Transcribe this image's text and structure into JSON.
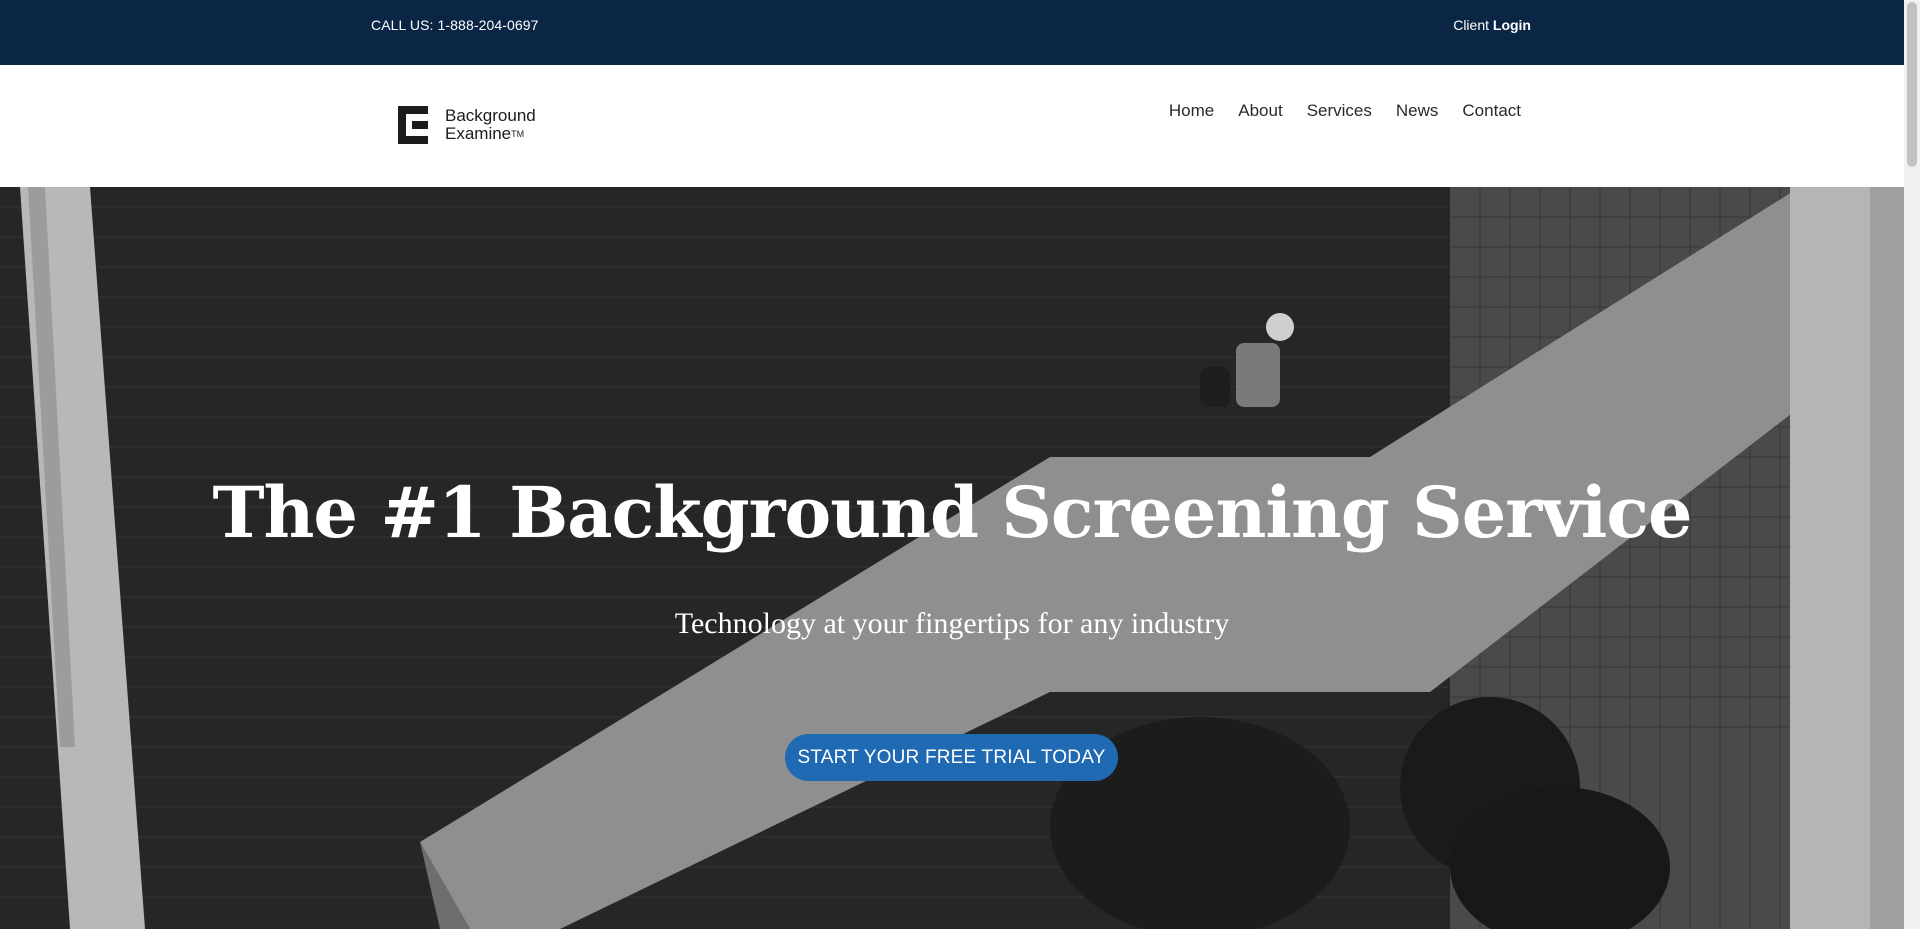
{
  "topbar": {
    "phone": "CALL US: 1-888-204-0697",
    "client_prefix": "Client",
    "client_login": "Login"
  },
  "logo": {
    "line1": "Background",
    "line2": "Examine",
    "tm": "TM"
  },
  "nav": {
    "home": "Home",
    "about": "About",
    "services": "Services",
    "news": "News",
    "contact": "Contact"
  },
  "hero": {
    "title": "The #1 Background Screening Service",
    "subtitle": "Technology at your fingertips for any industry",
    "cta": "START YOUR FREE TRIAL TODAY"
  },
  "colors": {
    "topbar_bg": "#0b2645",
    "cta_bg": "#1f6ab3",
    "hero_bg": "#3a3a3a"
  }
}
